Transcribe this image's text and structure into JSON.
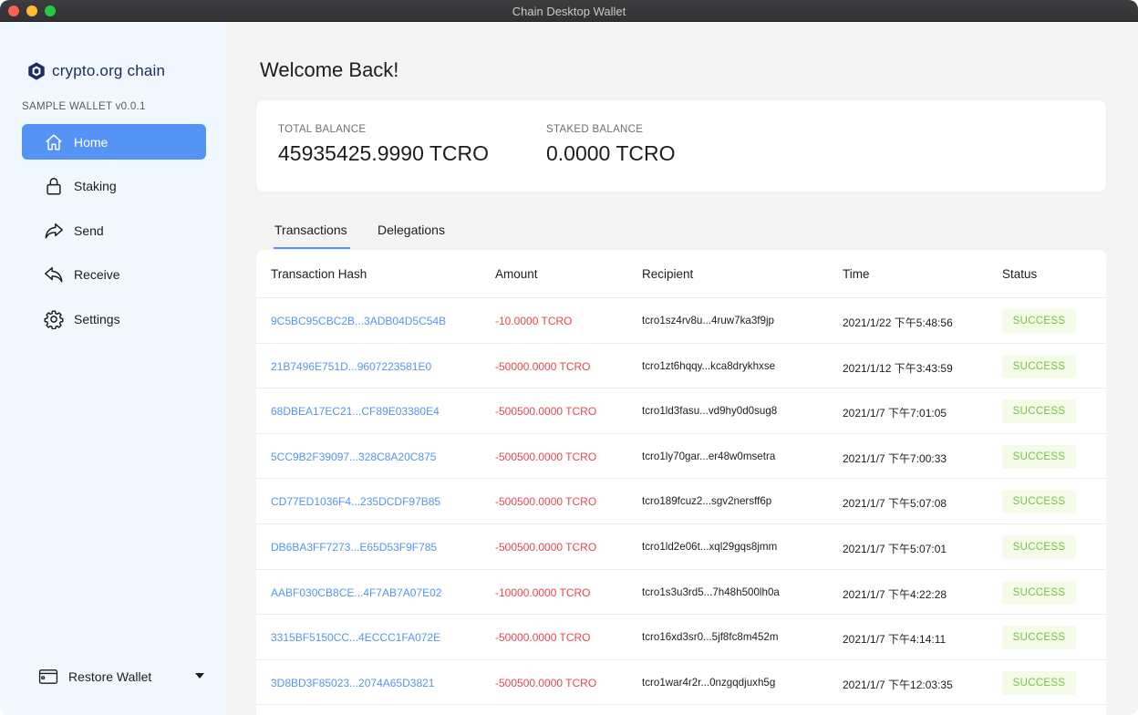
{
  "window": {
    "title": "Chain Desktop Wallet"
  },
  "sidebar": {
    "brand": "crypto.org chain",
    "version": "SAMPLE WALLET v0.0.1",
    "items": [
      {
        "label": "Home",
        "icon": "home-icon",
        "active": true
      },
      {
        "label": "Staking",
        "icon": "lock-icon",
        "active": false
      },
      {
        "label": "Send",
        "icon": "send-icon",
        "active": false
      },
      {
        "label": "Receive",
        "icon": "receive-icon",
        "active": false
      },
      {
        "label": "Settings",
        "icon": "gear-icon",
        "active": false
      }
    ],
    "restore_label": "Restore Wallet"
  },
  "main": {
    "welcome": "Welcome Back!",
    "total_balance_label": "TOTAL BALANCE",
    "total_balance_value": "45935425.9990 TCRO",
    "staked_balance_label": "STAKED BALANCE",
    "staked_balance_value": "0.0000 TCRO",
    "tabs": [
      "Transactions",
      "Delegations"
    ],
    "active_tab": "Transactions",
    "table": {
      "headers": [
        "Transaction Hash",
        "Amount",
        "Recipient",
        "Time",
        "Status"
      ],
      "rows": [
        {
          "hash": "9C5BC95CBC2B...3ADB04D5C54B",
          "amount": "-10.0000 TCRO",
          "recipient": "tcro1sz4rv8u...4ruw7ka3f9jp",
          "time": "2021/1/22 下午5:48:56",
          "status": "SUCCESS"
        },
        {
          "hash": "21B7496E751D...9607223581E0",
          "amount": "-50000.0000 TCRO",
          "recipient": "tcro1zt6hqqy...kca8drykhxse",
          "time": "2021/1/12 下午3:43:59",
          "status": "SUCCESS"
        },
        {
          "hash": "68DBEA17EC21...CF89E03380E4",
          "amount": "-500500.0000 TCRO",
          "recipient": "tcro1ld3fasu...vd9hy0d0sug8",
          "time": "2021/1/7 下午7:01:05",
          "status": "SUCCESS"
        },
        {
          "hash": "5CC9B2F39097...328C8A20C875",
          "amount": "-500500.0000 TCRO",
          "recipient": "tcro1ly70gar...er48w0msetra",
          "time": "2021/1/7 下午7:00:33",
          "status": "SUCCESS"
        },
        {
          "hash": "CD77ED1036F4...235DCDF97B85",
          "amount": "-500500.0000 TCRO",
          "recipient": "tcro189fcuz2...sgv2nersff6p",
          "time": "2021/1/7 下午5:07:08",
          "status": "SUCCESS"
        },
        {
          "hash": "DB6BA3FF7273...E65D53F9F785",
          "amount": "-500500.0000 TCRO",
          "recipient": "tcro1ld2e06t...xql29gqs8jmm",
          "time": "2021/1/7 下午5:07:01",
          "status": "SUCCESS"
        },
        {
          "hash": "AABF030CB8CE...4F7AB7A07E02",
          "amount": "-10000.0000 TCRO",
          "recipient": "tcro1s3u3rd5...7h48h500lh0a",
          "time": "2021/1/7 下午4:22:28",
          "status": "SUCCESS"
        },
        {
          "hash": "3315BF5150CC...4ECCC1FA072E",
          "amount": "-50000.0000 TCRO",
          "recipient": "tcro16xd3sr0...5jf8fc8m452m",
          "time": "2021/1/7 下午4:14:11",
          "status": "SUCCESS"
        },
        {
          "hash": "3D8BD3F85023...2074A65D3821",
          "amount": "-500500.0000 TCRO",
          "recipient": "tcro1war4r2r...0nzgqdjuxh5g",
          "time": "2021/1/7 下午12:03:35",
          "status": "SUCCESS"
        }
      ]
    }
  },
  "colors": {
    "accent": "#5594f5",
    "sidebar_bg": "#f2f8ff",
    "main_bg": "#f4f4f5",
    "negative": "#e5484d",
    "success_text": "#74c341",
    "success_bg": "#f4fbe8",
    "brand_navy": "#1b2e63"
  }
}
